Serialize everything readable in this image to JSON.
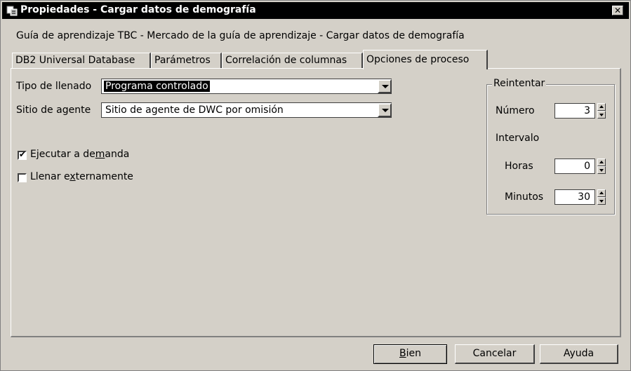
{
  "window": {
    "title": "Propiedades - Cargar datos de demografía",
    "close_glyph": "✕"
  },
  "subtitle": "Guía de aprendizaje TBC - Mercado de la guía de aprendizaje - Cargar datos de demografía",
  "tabs": [
    {
      "label": "DB2 Universal Database",
      "active": false
    },
    {
      "label": "Parámetros",
      "active": false
    },
    {
      "label": "Correlación de columnas",
      "active": false
    },
    {
      "label": "Opciones de proceso",
      "active": true
    }
  ],
  "form": {
    "fill_type": {
      "label": "Tipo de llenado",
      "value": "Programa controlado"
    },
    "agent_site": {
      "label": "Sitio de agente",
      "value": "Sitio de agente de DWC por omisión"
    },
    "run_on_demand": {
      "label_pre": "Ejecutar a de",
      "label_u": "m",
      "label_post": "anda",
      "checked": true,
      "check_glyph": "✔"
    },
    "fill_externally": {
      "label_pre": "Llenar e",
      "label_u": "x",
      "label_post": "ternamente",
      "checked": false
    }
  },
  "retry": {
    "title": "Reintentar",
    "number_label": "Número",
    "number_value": "3",
    "interval_label": "Intervalo",
    "hours_label": "Horas",
    "hours_value": "0",
    "minutes_label": "Minutos",
    "minutes_value": "30"
  },
  "buttons": {
    "ok_u": "B",
    "ok_rest": "ien",
    "cancel": "Cancelar",
    "help": "Ayuda"
  }
}
